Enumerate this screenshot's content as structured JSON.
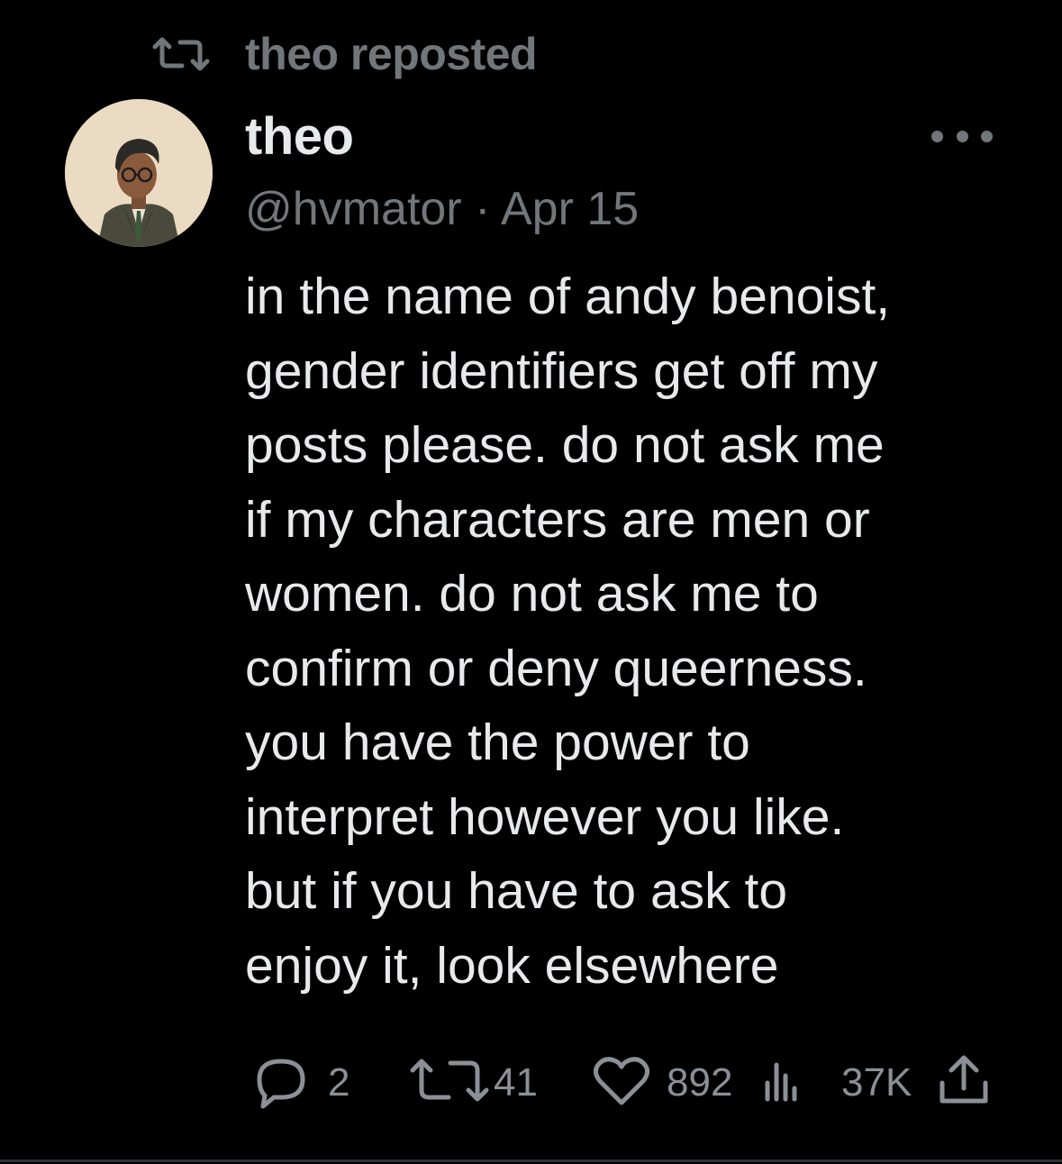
{
  "repost_header": {
    "icon": "repost-icon",
    "label": "theo reposted"
  },
  "post": {
    "avatar": "avatar-illustration",
    "display_name": "theo",
    "handle": "@hvmator",
    "separator": "·",
    "date": "Apr 15",
    "more_icon": "more-options-icon",
    "text_lines": [
      "in the name of andy benoist,",
      "gender identifiers get off my",
      "posts please. do not ask me",
      "if my characters are men or",
      "women. do not ask me to",
      "confirm or deny queerness.",
      "you have the power to",
      "interpret however you like.",
      "but if you have to ask to",
      "enjoy it, look elsewhere"
    ]
  },
  "actions": {
    "reply": {
      "icon": "reply-icon",
      "count": "2"
    },
    "repost": {
      "icon": "repost-icon",
      "count": "41"
    },
    "like": {
      "icon": "heart-icon",
      "count": "892"
    },
    "views": {
      "icon": "views-icon",
      "count": "37K"
    },
    "share": {
      "icon": "share-icon"
    }
  },
  "colors": {
    "background": "#000000",
    "primary_text": "#e7e9ea",
    "secondary_text": "#71767b",
    "action_text": "#8b9096"
  }
}
